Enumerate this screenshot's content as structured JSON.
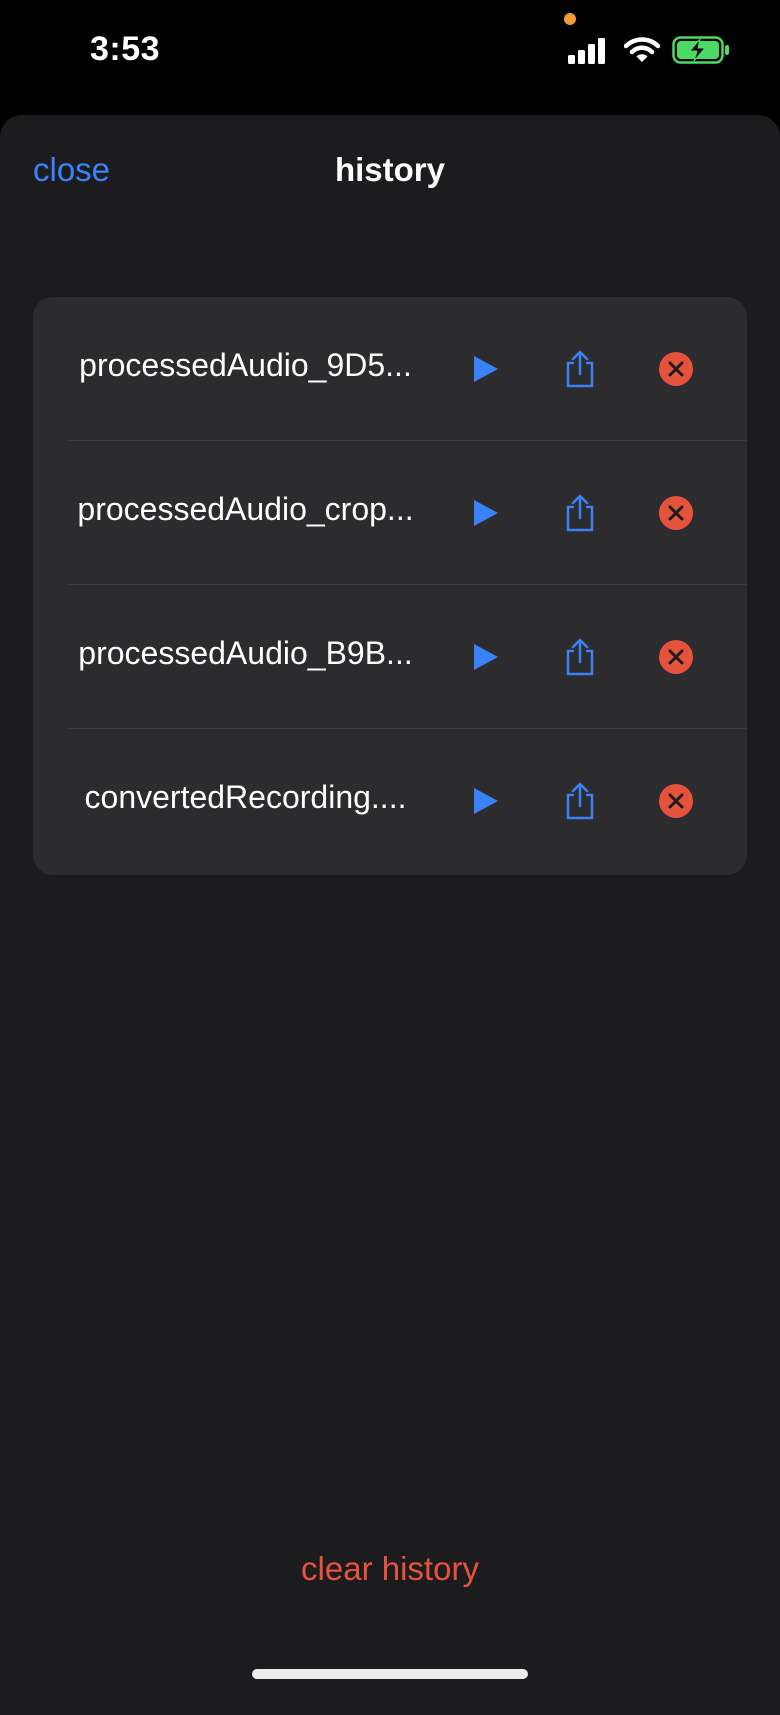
{
  "status_bar": {
    "time": "3:53",
    "icons": [
      "signal-icon",
      "wifi-icon",
      "battery-charging-icon"
    ],
    "privacy_indicator_color": "#f19a38"
  },
  "header": {
    "close_label": "close",
    "title": "history"
  },
  "history": {
    "items": [
      {
        "name": "processedAudio_9D5..."
      },
      {
        "name": "processedAudio_crop..."
      },
      {
        "name": "processedAudio_B9B..."
      },
      {
        "name": "convertedRecording...."
      }
    ],
    "row_actions": [
      "play-icon",
      "share-icon",
      "delete-icon"
    ]
  },
  "footer": {
    "clear_label": "clear history"
  },
  "colors": {
    "accent_blue": "#3b82f6",
    "destructive_red": "#e5533d",
    "sheet_background": "#1c1c1e",
    "list_background": "#2c2c2e"
  }
}
